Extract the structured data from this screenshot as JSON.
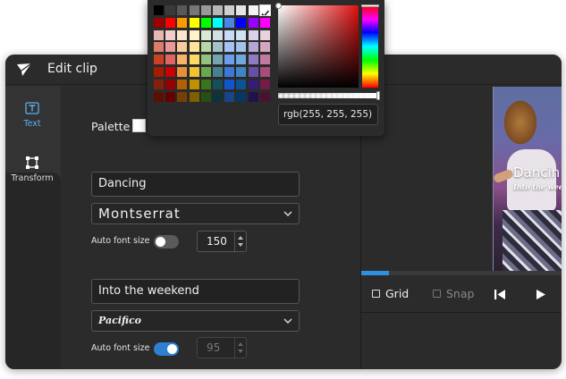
{
  "window": {
    "title": "Edit clip"
  },
  "rail": {
    "items": [
      {
        "label": "Text",
        "icon": "text-icon",
        "active": true
      },
      {
        "label": "Transform",
        "icon": "transform-icon",
        "active": false
      }
    ]
  },
  "panel": {
    "palette_label": "Palette",
    "palette_color": "#ffffff",
    "layers": [
      {
        "text": "Dancing",
        "font": "Montserrat",
        "auto_font_size_label": "Auto font size",
        "auto_font_size": false,
        "font_size": "150"
      },
      {
        "text": "Into the weekend",
        "font": "Pacifico",
        "auto_font_size_label": "Auto font size",
        "auto_font_size": true,
        "font_size": "95"
      }
    ]
  },
  "preview": {
    "title_text": "Dancin",
    "sub_text": "Into the weeke",
    "progress": 0.14
  },
  "controls": {
    "grid_label": "Grid",
    "snap_label": "Snap"
  },
  "picker": {
    "value": "rgb(255, 255, 255)",
    "selected_swatch": "#ffffff",
    "swatches": [
      [
        "#000000",
        "#3a3a3a",
        "#585858",
        "#777777",
        "#999999",
        "#b7b7b7",
        "#cfcfcf",
        "#e5e5e5",
        "#f3f3f3",
        "#ffffff"
      ],
      [
        "#9a0000",
        "#ff0000",
        "#ff9900",
        "#ffff00",
        "#00ff00",
        "#00ffff",
        "#4a86e8",
        "#0000ff",
        "#9900ff",
        "#ff00ff"
      ],
      [
        "#e6b8af",
        "#f4cccc",
        "#fce5cd",
        "#fff2cc",
        "#d9ead3",
        "#d0e0e3",
        "#c9daf8",
        "#cfe2f3",
        "#d9d2e9",
        "#ead1dc"
      ],
      [
        "#dd7e6b",
        "#ea9999",
        "#f9cb9c",
        "#ffe599",
        "#b6d7a8",
        "#a2c4c9",
        "#a4c2f4",
        "#9fc5e8",
        "#b4a7d6",
        "#d5a6bd"
      ],
      [
        "#cc4125",
        "#e06666",
        "#f6b26b",
        "#ffd966",
        "#93c47d",
        "#76a5af",
        "#6d9eeb",
        "#6fa8dc",
        "#8e7cc3",
        "#c27ba0"
      ],
      [
        "#a61c00",
        "#cc0000",
        "#e69138",
        "#f1c232",
        "#6aa84f",
        "#45818e",
        "#3c78d8",
        "#3d85c6",
        "#674ea7",
        "#a64d79"
      ],
      [
        "#85200c",
        "#990000",
        "#b45f06",
        "#bf9000",
        "#38761d",
        "#134f5c",
        "#1155cc",
        "#0b5394",
        "#351c75",
        "#741b47"
      ],
      [
        "#5b0f00",
        "#660000",
        "#783f04",
        "#7f6000",
        "#274e13",
        "#0c343d",
        "#1c4587",
        "#073763",
        "#20124d",
        "#4c1130"
      ]
    ]
  }
}
